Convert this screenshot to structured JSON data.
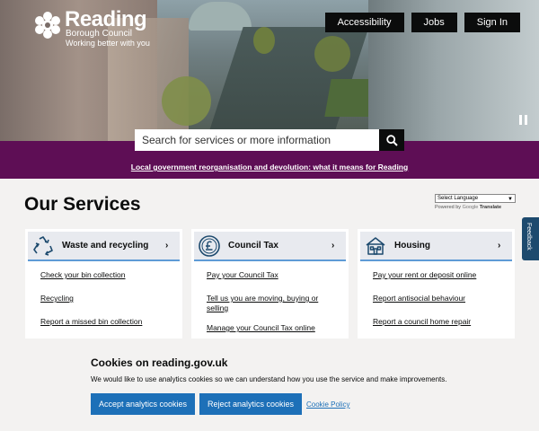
{
  "header": {
    "logo_name": "Reading",
    "logo_sub": "Borough Council",
    "logo_tagline": "Working better with you",
    "nav": [
      "Accessibility",
      "Jobs",
      "Sign In"
    ]
  },
  "search": {
    "placeholder": "Search for services or more information",
    "icon": "search-icon"
  },
  "notice": {
    "link_text": "Local government reorganisation and devolution: what it means for Reading"
  },
  "main": {
    "title": "Our Services",
    "language_select": "Select Language",
    "powered_by": "Powered by",
    "google": "Google",
    "translate": "Translate",
    "feedback_label": "Feedback"
  },
  "services": [
    {
      "title": "Waste and recycling",
      "icon": "recycling-icon",
      "links": [
        "Check your bin collection",
        "Recycling",
        "Report a missed bin collection"
      ]
    },
    {
      "title": "Council Tax",
      "icon": "pound-icon",
      "links": [
        "Pay your Council Tax",
        "Tell us you are moving, buying or selling",
        "Manage your Council Tax online"
      ]
    },
    {
      "title": "Housing",
      "icon": "house-icon",
      "links": [
        "Pay your rent or deposit online",
        "Report antisocial behaviour",
        "Report a council home repair"
      ]
    }
  ],
  "cookie_banner": {
    "title": "Cookies on reading.gov.uk",
    "text": "We would like to use analytics cookies so we can understand how you use the service and make improvements.",
    "accept_label": "Accept analytics cookies",
    "reject_label": "Reject analytics cookies",
    "policy_label": "Cookie Policy"
  },
  "colors": {
    "band_purple": "#5e0e55",
    "button_blue": "#1d70b8",
    "feedback_tab": "#1d4a6e",
    "card_accent": "#5e9bd6"
  }
}
